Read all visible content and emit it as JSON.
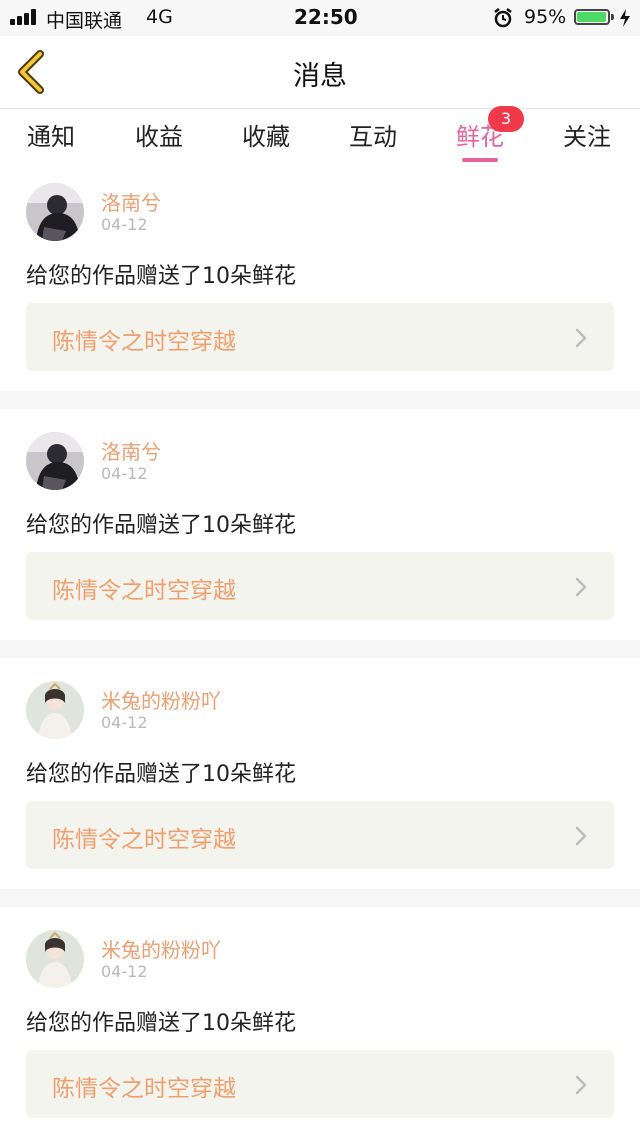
{
  "status_bar": {
    "carrier": "中国联通",
    "network": "4G",
    "time": "22:50",
    "battery_percent": "95%",
    "icons": [
      "signal-icon",
      "alarm-icon",
      "battery-icon",
      "charging-icon"
    ]
  },
  "nav": {
    "title": "消息",
    "back_icon": "chevron-left-icon",
    "accent_color": "#e3649c"
  },
  "tabs": [
    {
      "label": "通知"
    },
    {
      "label": "收益"
    },
    {
      "label": "收藏"
    },
    {
      "label": "互动"
    },
    {
      "label": "鲜花",
      "active": true,
      "badge": "3"
    },
    {
      "label": "关注"
    }
  ],
  "feed": [
    {
      "user": "洛南兮",
      "date": "04-12",
      "message": "给您的作品赠送了10朵鲜花",
      "work": "陈情令之时空穿越"
    },
    {
      "user": "洛南兮",
      "date": "04-12",
      "message": "给您的作品赠送了10朵鲜花",
      "work": "陈情令之时空穿越"
    },
    {
      "user": "米兔的粉粉吖",
      "date": "04-12",
      "message": "给您的作品赠送了10朵鲜花",
      "work": "陈情令之时空穿越"
    },
    {
      "user": "米兔的粉粉吖",
      "date": "04-12",
      "message": "给您的作品赠送了10朵鲜花",
      "work": "陈情令之时空穿越"
    }
  ]
}
